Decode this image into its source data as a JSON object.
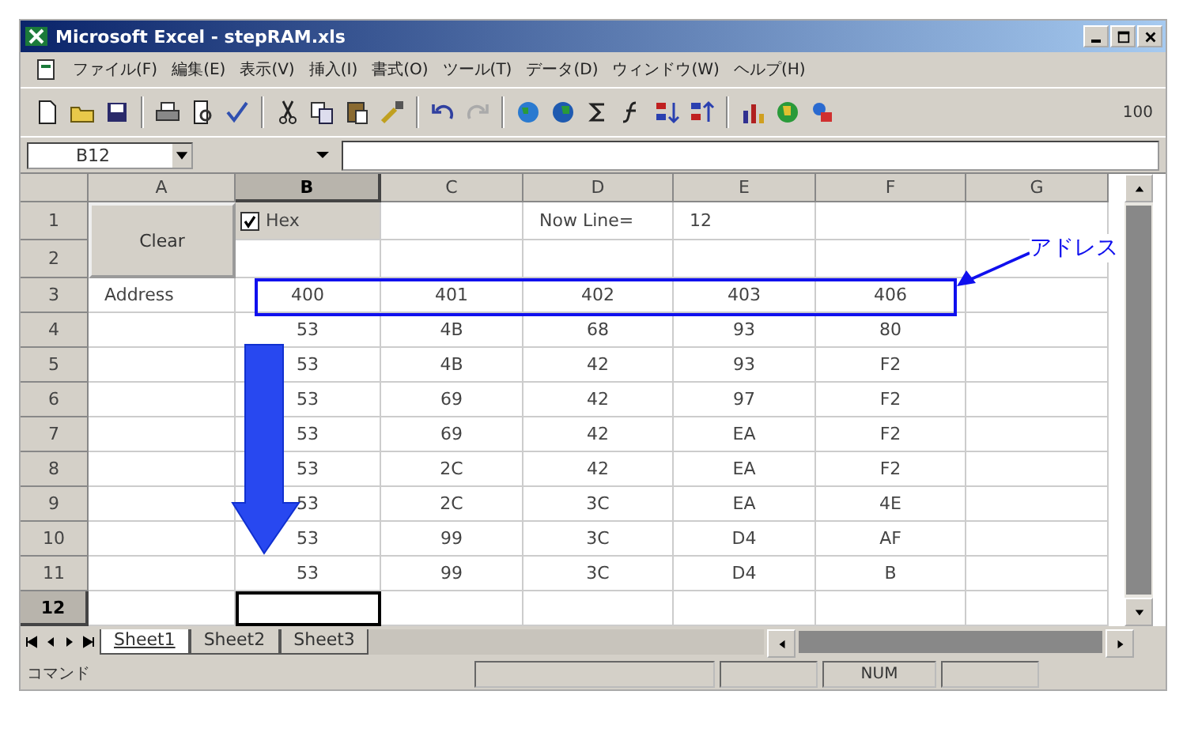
{
  "window": {
    "title": "Microsoft Excel - stepRAM.xls"
  },
  "menu": [
    {
      "label": "ファイル(F)"
    },
    {
      "label": "編集(E)"
    },
    {
      "label": "表示(V)"
    },
    {
      "label": "挿入(I)"
    },
    {
      "label": "書式(O)"
    },
    {
      "label": "ツール(T)"
    },
    {
      "label": "データ(D)"
    },
    {
      "label": "ウィンドウ(W)"
    },
    {
      "label": "ヘルプ(H)"
    }
  ],
  "toolbar": {
    "zoom": "100"
  },
  "formula_bar": {
    "name_box": "B12"
  },
  "columns": [
    {
      "label": "A",
      "selected": false
    },
    {
      "label": "B",
      "selected": true
    },
    {
      "label": "C",
      "selected": false
    },
    {
      "label": "D",
      "selected": false
    },
    {
      "label": "E",
      "selected": false
    },
    {
      "label": "F",
      "selected": false
    },
    {
      "label": "G",
      "selected": false
    }
  ],
  "controls": {
    "clear_button": "Clear",
    "hex_checkbox": {
      "label": "Hex",
      "checked": true
    }
  },
  "rows": [
    {
      "label": "1",
      "selected": false,
      "cells": {
        "D": "Now Line=",
        "E": "12"
      }
    },
    {
      "label": "2",
      "selected": false,
      "cells": {}
    },
    {
      "label": "3",
      "selected": false,
      "cells": {
        "A": "Address",
        "B": "400",
        "C": "401",
        "D": "402",
        "E": "403",
        "F": "406"
      }
    },
    {
      "label": "4",
      "selected": false,
      "cells": {
        "B": "53",
        "C": "4B",
        "D": "68",
        "E": "93",
        "F": "80"
      }
    },
    {
      "label": "5",
      "selected": false,
      "cells": {
        "B": "53",
        "C": "4B",
        "D": "42",
        "E": "93",
        "F": "F2"
      }
    },
    {
      "label": "6",
      "selected": false,
      "cells": {
        "B": "53",
        "C": "69",
        "D": "42",
        "E": "97",
        "F": "F2"
      }
    },
    {
      "label": "7",
      "selected": false,
      "cells": {
        "B": "53",
        "C": "69",
        "D": "42",
        "E": "EA",
        "F": "F2"
      }
    },
    {
      "label": "8",
      "selected": false,
      "cells": {
        "B": "53",
        "C": "2C",
        "D": "42",
        "E": "EA",
        "F": "F2"
      }
    },
    {
      "label": "9",
      "selected": false,
      "cells": {
        "B": "53",
        "C": "2C",
        "D": "3C",
        "E": "EA",
        "F": "4E"
      }
    },
    {
      "label": "10",
      "selected": false,
      "cells": {
        "B": "53",
        "C": "99",
        "D": "3C",
        "E": "D4",
        "F": "AF"
      }
    },
    {
      "label": "11",
      "selected": false,
      "cells": {
        "B": "53",
        "C": "99",
        "D": "3C",
        "E": "D4",
        "F": "B"
      }
    },
    {
      "label": "12",
      "selected": true,
      "cells": {}
    }
  ],
  "annotation": {
    "label": "アドレス"
  },
  "sheet_tabs": [
    {
      "label": "Sheet1",
      "selected": true
    },
    {
      "label": "Sheet2",
      "selected": false
    },
    {
      "label": "Sheet3",
      "selected": false
    }
  ],
  "status_bar": {
    "mode": "コマンド",
    "indicator": "NUM"
  }
}
